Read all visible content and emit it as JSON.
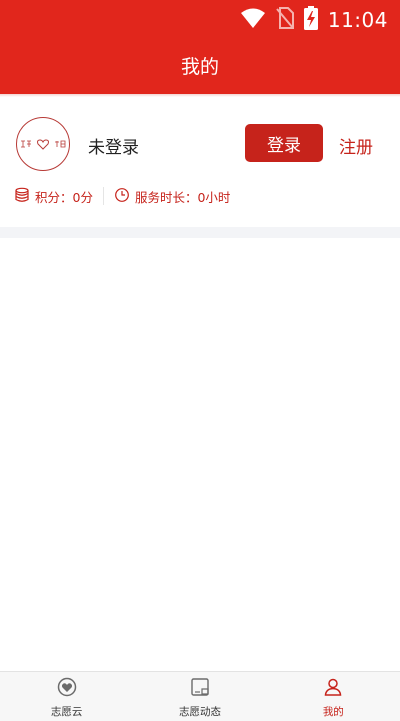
{
  "status_bar": {
    "time": "11:04",
    "icons": [
      "wifi-icon",
      "no-sim-icon",
      "battery-charging-icon"
    ]
  },
  "header": {
    "title": "我的"
  },
  "profile": {
    "avatar_icon": "organization-logo",
    "username": "未登录",
    "login_label": "登录",
    "register_label": "注册",
    "points_label": "积分：0分",
    "service_hours_label": "服务时长：0小时"
  },
  "tabbar": {
    "items": [
      {
        "label": "志愿云",
        "icon": "heart-badge-icon",
        "active": false
      },
      {
        "label": "志愿动态",
        "icon": "news-icon",
        "active": false
      },
      {
        "label": "我的",
        "icon": "person-icon",
        "active": true
      }
    ]
  },
  "colors": {
    "primary": "#e1261c",
    "button": "#c6231b",
    "separator": "#f3f4f7"
  }
}
